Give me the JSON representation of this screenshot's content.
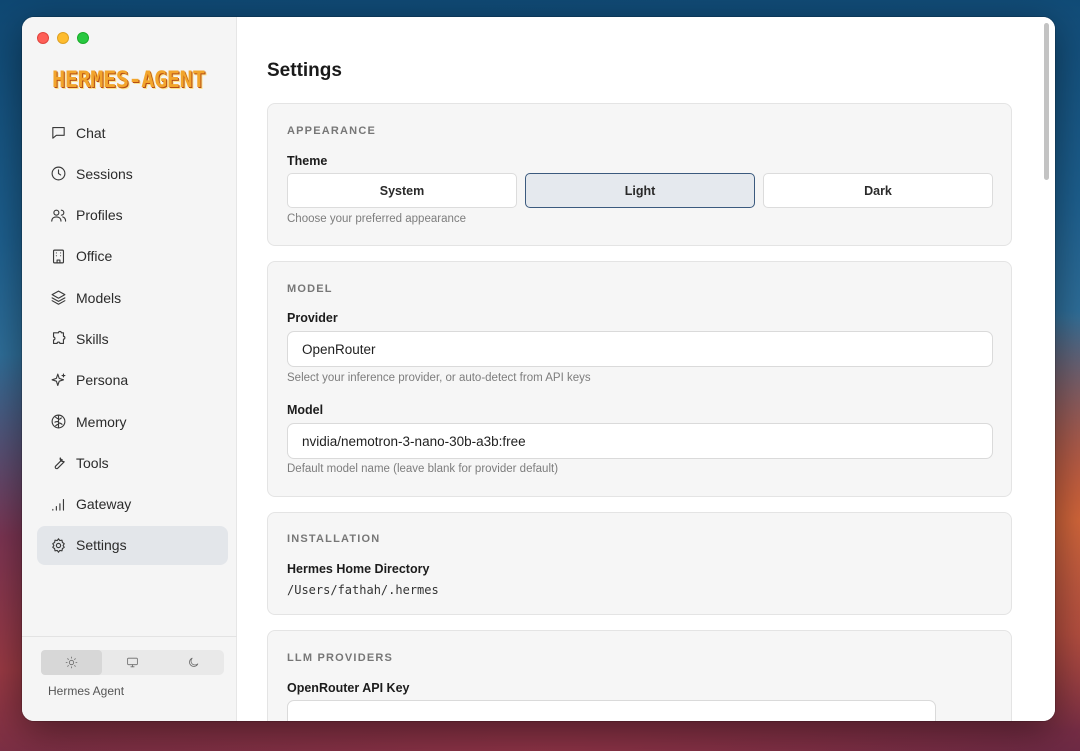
{
  "app": {
    "logo_text": "HERMES-AGENT",
    "name": "Hermes Agent"
  },
  "sidebar": {
    "items": [
      {
        "label": "Chat",
        "icon": "chat-bubble-icon"
      },
      {
        "label": "Sessions",
        "icon": "clock-icon"
      },
      {
        "label": "Profiles",
        "icon": "users-icon"
      },
      {
        "label": "Office",
        "icon": "building-icon"
      },
      {
        "label": "Models",
        "icon": "layers-icon"
      },
      {
        "label": "Skills",
        "icon": "puzzle-icon"
      },
      {
        "label": "Persona",
        "icon": "sparkles-icon"
      },
      {
        "label": "Memory",
        "icon": "brain-icon"
      },
      {
        "label": "Tools",
        "icon": "wrench-icon"
      },
      {
        "label": "Gateway",
        "icon": "signal-bars-icon"
      },
      {
        "label": "Settings",
        "icon": "gear-icon",
        "active": true
      }
    ],
    "theme_switch": {
      "selected": "light",
      "options": [
        "sun-icon",
        "monitor-icon",
        "moon-icon"
      ]
    }
  },
  "page": {
    "title": "Settings"
  },
  "appearance": {
    "heading": "APPEARANCE",
    "theme_label": "Theme",
    "options": [
      "System",
      "Light",
      "Dark"
    ],
    "selected": "Light",
    "hint": "Choose your preferred appearance"
  },
  "model": {
    "heading": "MODEL",
    "provider_label": "Provider",
    "provider_value": "OpenRouter",
    "provider_hint": "Select your inference provider, or auto-detect from API keys",
    "model_label": "Model",
    "model_value": "nvidia/nemotron-3-nano-30b-a3b:free",
    "model_hint": "Default model name (leave blank for provider default)"
  },
  "installation": {
    "heading": "INSTALLATION",
    "home_label": "Hermes Home Directory",
    "home_value": "/Users/fathah/.hermes"
  },
  "llm_providers": {
    "heading": "LLM PROVIDERS",
    "openrouter_label": "OpenRouter API Key",
    "openrouter_value": ""
  },
  "colors": {
    "accent_border": "#3b5a7e",
    "active_nav_bg": "#e3e6ea",
    "logo": "#f2a52c"
  }
}
